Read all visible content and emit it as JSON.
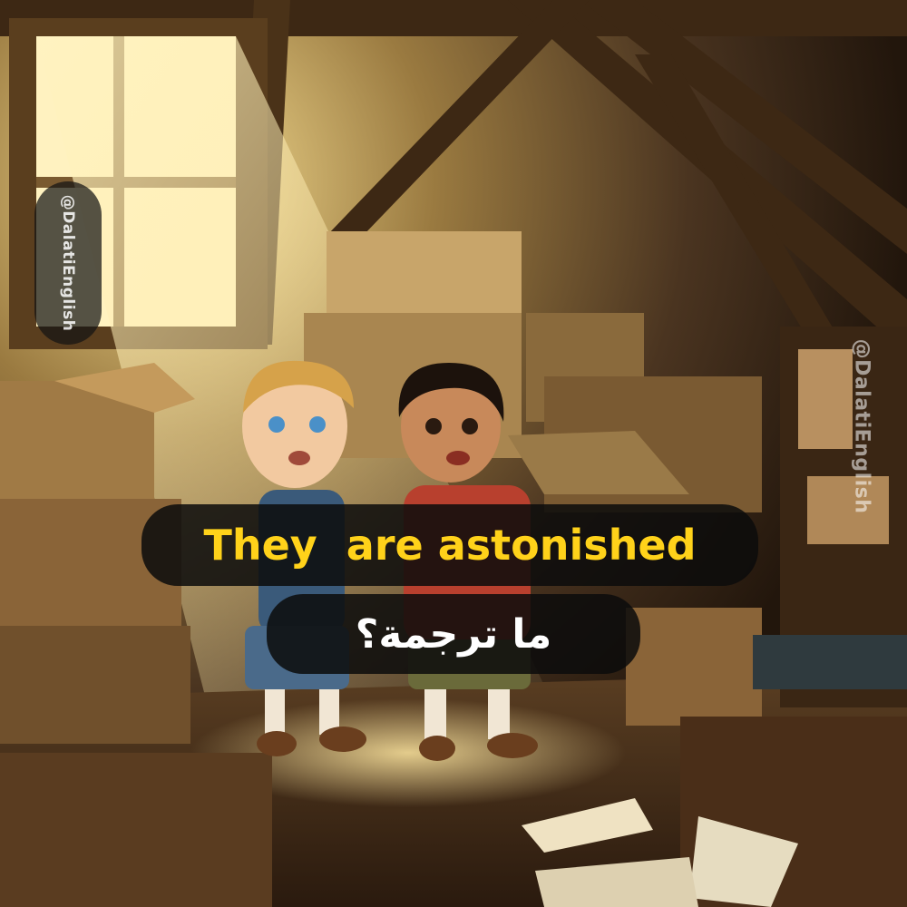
{
  "watermark": {
    "left_handle": "@DalatiEnglish",
    "right_handle": "@DalatiEnglish"
  },
  "caption": {
    "english": "They  are astonished",
    "arabic": "ما ترجمة؟"
  },
  "colors": {
    "caption_text": "#ffd21a",
    "caption_bg": "#0c0c0c",
    "arabic_text": "#ffffff",
    "sunlight": "#ffe9a0",
    "wood_dark": "#3a2614"
  },
  "scene": {
    "subjects": [
      "blond-boy",
      "dark-haired-boy"
    ],
    "setting": "attic"
  }
}
